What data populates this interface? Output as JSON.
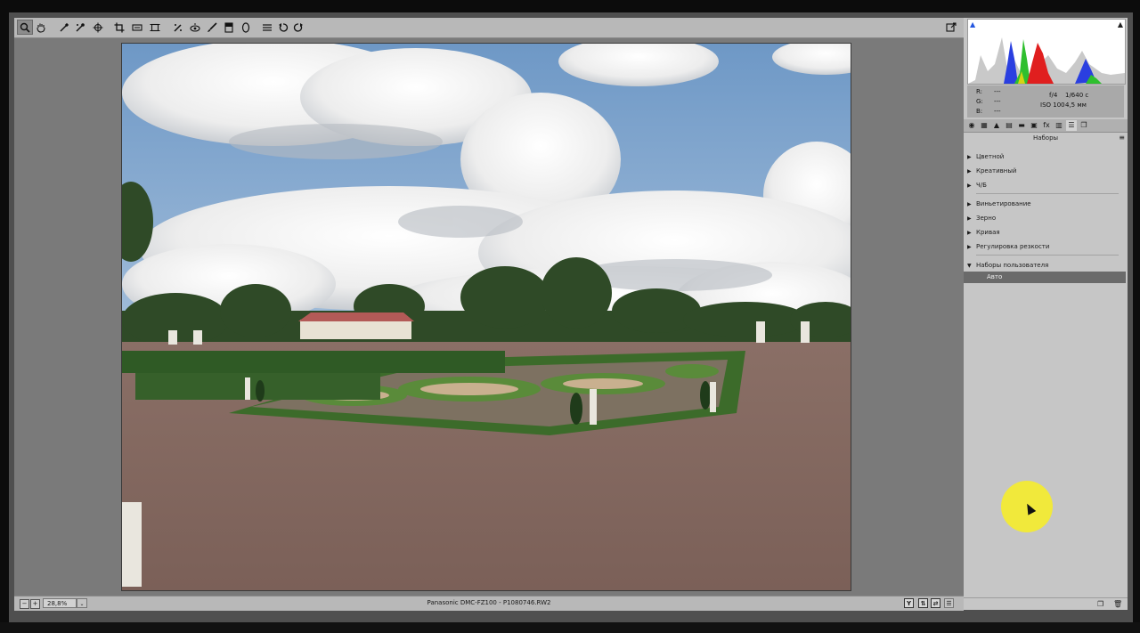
{
  "toolbar": {
    "tools": [
      {
        "name": "zoom-tool-icon",
        "glyph": "🔍",
        "active": true
      },
      {
        "name": "hand-tool-icon",
        "glyph": "✋",
        "active": false
      },
      {
        "name": "white-balance-tool-icon",
        "glyph": "✒",
        "active": false
      },
      {
        "name": "color-sampler-tool-icon",
        "glyph": "✎",
        "active": false
      },
      {
        "name": "targeted-adjustment-tool-icon",
        "glyph": "⊕",
        "active": false
      },
      {
        "name": "crop-tool-icon",
        "glyph": "⌗",
        "active": false
      },
      {
        "name": "straighten-tool-icon",
        "glyph": "▭",
        "active": false
      },
      {
        "name": "transform-tool-icon",
        "glyph": "⊡",
        "active": false
      },
      {
        "name": "spot-removal-tool-icon",
        "glyph": "✕",
        "active": false
      },
      {
        "name": "red-eye-tool-icon",
        "glyph": "◉",
        "active": false
      },
      {
        "name": "adjustment-brush-icon",
        "glyph": "✐",
        "active": false
      },
      {
        "name": "graduated-filter-icon",
        "glyph": "▥",
        "active": false
      },
      {
        "name": "radial-filter-icon",
        "glyph": "◯",
        "active": false
      },
      {
        "name": "preferences-icon",
        "glyph": "☰",
        "active": false
      },
      {
        "name": "rotate-left-icon",
        "glyph": "↺",
        "active": false
      },
      {
        "name": "rotate-right-icon",
        "glyph": "↻",
        "active": false
      }
    ]
  },
  "readout": {
    "r_label": "R:",
    "g_label": "G:",
    "b_label": "B:",
    "r_value": "---",
    "g_value": "---",
    "b_value": "---",
    "aperture": "f/4",
    "shutter": "1/640 с",
    "iso": "ISO 100",
    "focal": "4,5 мм"
  },
  "panel": {
    "section_title": "Наборы",
    "groups_a": [
      "Цветной",
      "Креативный",
      "Ч/Б"
    ],
    "groups_b": [
      "Виньетирование",
      "Зерно",
      "Кривая",
      "Регулировка резкости"
    ],
    "user_group": "Наборы пользователя",
    "user_preset": "Авто"
  },
  "statusbar": {
    "zoom": "28,8%",
    "camera": "Panasonic DMC-FZ100",
    "separator": " - ",
    "filename": "P1080746.RW2",
    "view_y": "Y"
  },
  "colors": {
    "app_bg": "#4f4f4f",
    "panel_bg": "#c6c6c6",
    "highlight": "#f4eb2f",
    "selected_preset": "#6a6a6a"
  }
}
